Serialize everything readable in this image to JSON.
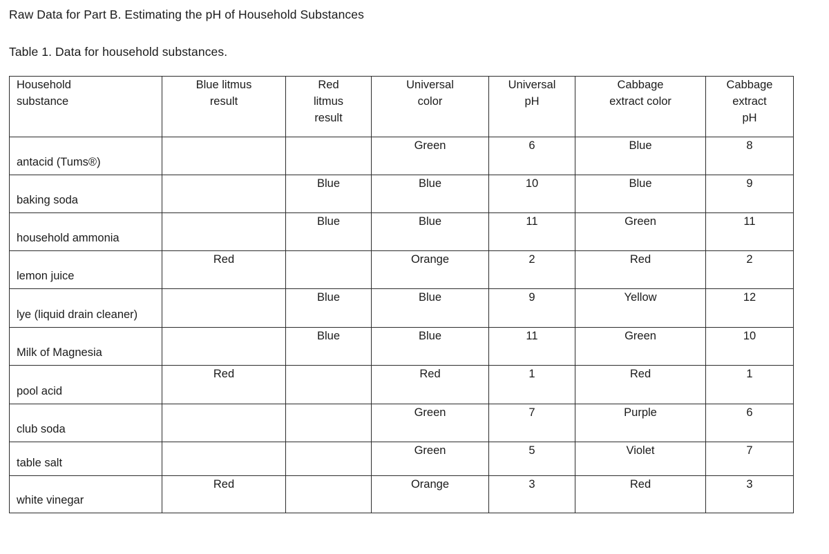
{
  "document": {
    "heading": "Raw Data for Part B. Estimating the pH of Household Substances",
    "caption": "Table 1. Data for household substances."
  },
  "table": {
    "headers": [
      "Household substance",
      "Blue litmus result",
      "Red litmus result",
      "Universal color",
      "Universal pH",
      "Cabbage extract color",
      "Cabbage extract pH"
    ],
    "header_lines": [
      [
        "Household",
        "substance"
      ],
      [
        "Blue litmus",
        "result"
      ],
      [
        "Red",
        "litmus",
        "result"
      ],
      [
        "Universal",
        "color"
      ],
      [
        "Universal",
        "pH"
      ],
      [
        "Cabbage",
        "extract color"
      ],
      [
        "Cabbage",
        "extract",
        "pH"
      ]
    ],
    "rows": [
      {
        "substance": "antacid (Tums®)",
        "blue_litmus": "",
        "red_litmus": "",
        "universal_color": "Green",
        "universal_ph": "6",
        "cabbage_color": "Blue",
        "cabbage_ph": "8"
      },
      {
        "substance": "baking soda",
        "blue_litmus": "",
        "red_litmus": "Blue",
        "universal_color": "Blue",
        "universal_ph": "10",
        "cabbage_color": "Blue",
        "cabbage_ph": "9"
      },
      {
        "substance": "household ammonia",
        "blue_litmus": "",
        "red_litmus": "Blue",
        "universal_color": "Blue",
        "universal_ph": "11",
        "cabbage_color": "Green",
        "cabbage_ph": "11"
      },
      {
        "substance": "lemon juice",
        "blue_litmus": "Red",
        "red_litmus": "",
        "universal_color": "Orange",
        "universal_ph": "2",
        "cabbage_color": "Red",
        "cabbage_ph": "2"
      },
      {
        "substance": "lye (liquid drain cleaner)",
        "blue_litmus": "",
        "red_litmus": "Blue",
        "universal_color": "Blue",
        "universal_ph": "9",
        "cabbage_color": "Yellow",
        "cabbage_ph": "12"
      },
      {
        "substance": "Milk of Magnesia",
        "blue_litmus": "",
        "red_litmus": "Blue",
        "universal_color": "Blue",
        "universal_ph": "11",
        "cabbage_color": "Green",
        "cabbage_ph": "10"
      },
      {
        "substance": "pool acid",
        "blue_litmus": "Red",
        "red_litmus": "",
        "universal_color": "Red",
        "universal_ph": "1",
        "cabbage_color": "Red",
        "cabbage_ph": "1"
      },
      {
        "substance": "club soda",
        "blue_litmus": "",
        "red_litmus": "",
        "universal_color": "Green",
        "universal_ph": "7",
        "cabbage_color": "Purple",
        "cabbage_ph": "6"
      },
      {
        "substance": "table salt",
        "blue_litmus": "",
        "red_litmus": "",
        "universal_color": "Green",
        "universal_ph": "5",
        "cabbage_color": "Violet",
        "cabbage_ph": "7"
      },
      {
        "substance": "white vinegar",
        "blue_litmus": "Red",
        "red_litmus": "",
        "universal_color": "Orange",
        "universal_ph": "3",
        "cabbage_color": "Red",
        "cabbage_ph": "3"
      }
    ]
  },
  "colors": {
    "text": "#1b1b1b",
    "border": "#2b2b2b",
    "background": "#ffffff"
  }
}
